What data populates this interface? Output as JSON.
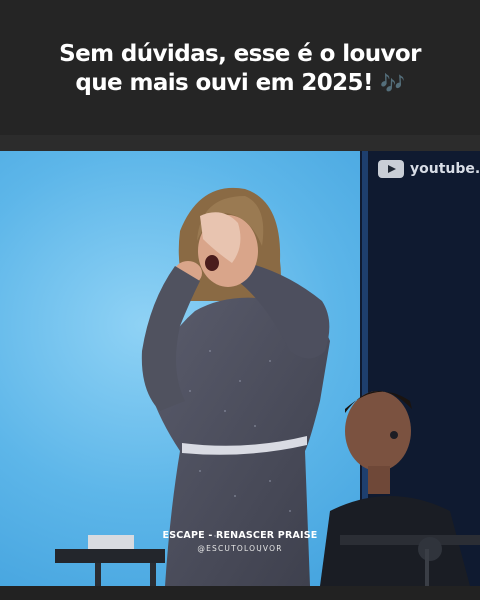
{
  "post": {
    "caption_line1": "Sem dúvidas, esse é o louvor",
    "caption_line2": "que mais ouvi em 2025!",
    "caption_emoji": "🎶"
  },
  "video": {
    "watermark_text": "youtube.c",
    "watermark_icon": "youtube-play-icon",
    "song_title": "ESCAPE - RENASCER PRAISE",
    "channel_handle": "@ESCUTOLOUVOR"
  },
  "colors": {
    "background": "#222222",
    "stage_blue": "#5fb8ea",
    "dress": "#4a4c5a"
  }
}
